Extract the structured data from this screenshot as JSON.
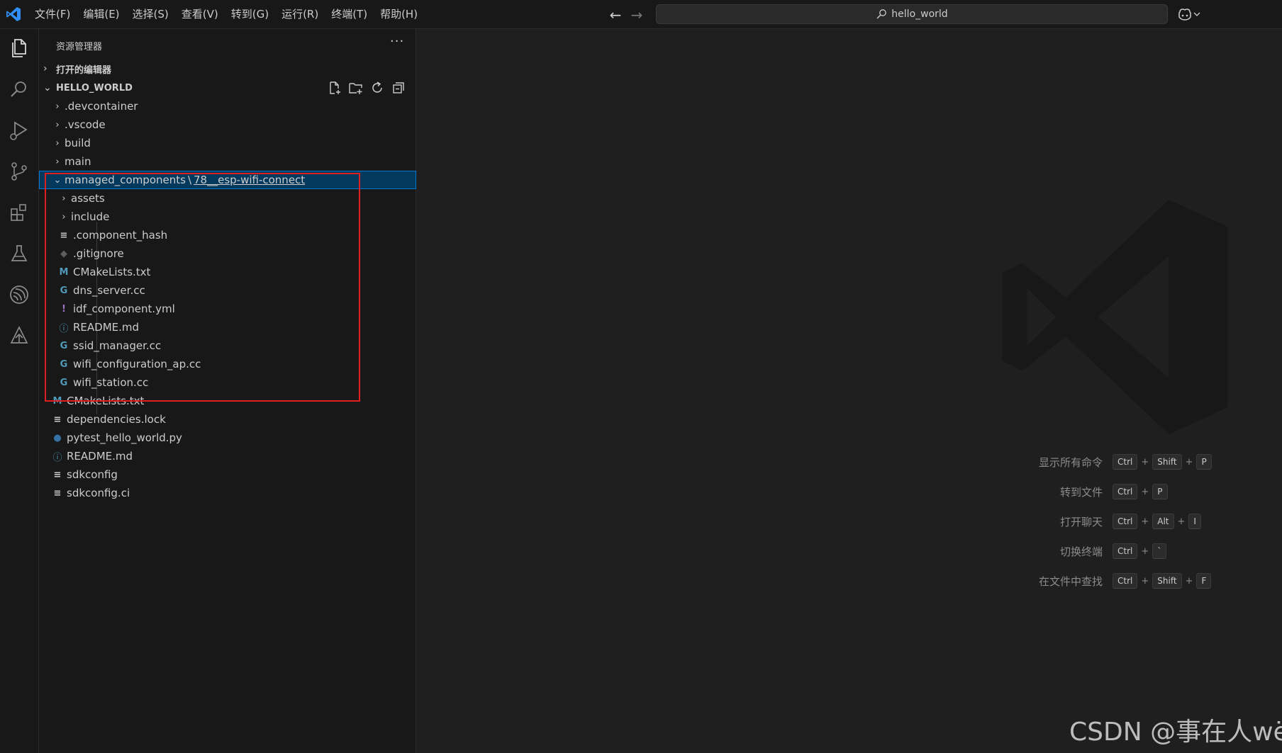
{
  "titlebar": {
    "menu": [
      "文件(F)",
      "编辑(E)",
      "选择(S)",
      "查看(V)",
      "转到(G)",
      "运行(R)",
      "终端(T)",
      "帮助(H)"
    ],
    "search_text": "hello_world"
  },
  "sidebar": {
    "title": "资源管理器",
    "more": "···",
    "open_editors": "打开的编辑器",
    "workspace": "HELLO_WORLD",
    "tree": [
      {
        "label": ".devcontainer",
        "kind": "folder"
      },
      {
        "label": ".vscode",
        "kind": "folder"
      },
      {
        "label": "build",
        "kind": "folder"
      },
      {
        "label": "main",
        "kind": "folder"
      },
      {
        "label": "managed_components",
        "kind": "folder-open",
        "crumb": "78__esp-wifi-connect"
      },
      {
        "label": "assets",
        "kind": "folder"
      },
      {
        "label": "include",
        "kind": "folder"
      },
      {
        "label": ".component_hash",
        "kind": "file"
      },
      {
        "label": ".gitignore",
        "kind": "file"
      },
      {
        "label": "CMakeLists.txt",
        "kind": "file"
      },
      {
        "label": "dns_server.cc",
        "kind": "file"
      },
      {
        "label": "idf_component.yml",
        "kind": "file"
      },
      {
        "label": "README.md",
        "kind": "file"
      },
      {
        "label": "ssid_manager.cc",
        "kind": "file"
      },
      {
        "label": "wifi_configuration_ap.cc",
        "kind": "file"
      },
      {
        "label": "wifi_station.cc",
        "kind": "file"
      },
      {
        "label": "CMakeLists.txt",
        "kind": "file"
      },
      {
        "label": "dependencies.lock",
        "kind": "file"
      },
      {
        "label": "pytest_hello_world.py",
        "kind": "file"
      },
      {
        "label": "README.md",
        "kind": "file"
      },
      {
        "label": "sdkconfig",
        "kind": "file"
      },
      {
        "label": "sdkconfig.ci",
        "kind": "file"
      }
    ]
  },
  "editor": {
    "shortcuts": [
      {
        "label": "显示所有命令",
        "keys": [
          "Ctrl",
          "Shift",
          "P"
        ]
      },
      {
        "label": "转到文件",
        "keys": [
          "Ctrl",
          "P"
        ]
      },
      {
        "label": "打开聊天",
        "keys": [
          "Ctrl",
          "Alt",
          "I"
        ]
      },
      {
        "label": "切换终端",
        "keys": [
          "Ctrl",
          "`"
        ]
      },
      {
        "label": "在文件中查找",
        "keys": [
          "Ctrl",
          "Shift",
          "F"
        ]
      }
    ],
    "watermark": "CSDN @事在人wëi"
  },
  "colors": {
    "accent": "#0078d4",
    "highlight_box": "#e02020",
    "cpp_icon": "#519aba",
    "cmake_icon": "#519aba",
    "yaml_icon": "#a074c4",
    "python_icon": "#3572a5"
  }
}
